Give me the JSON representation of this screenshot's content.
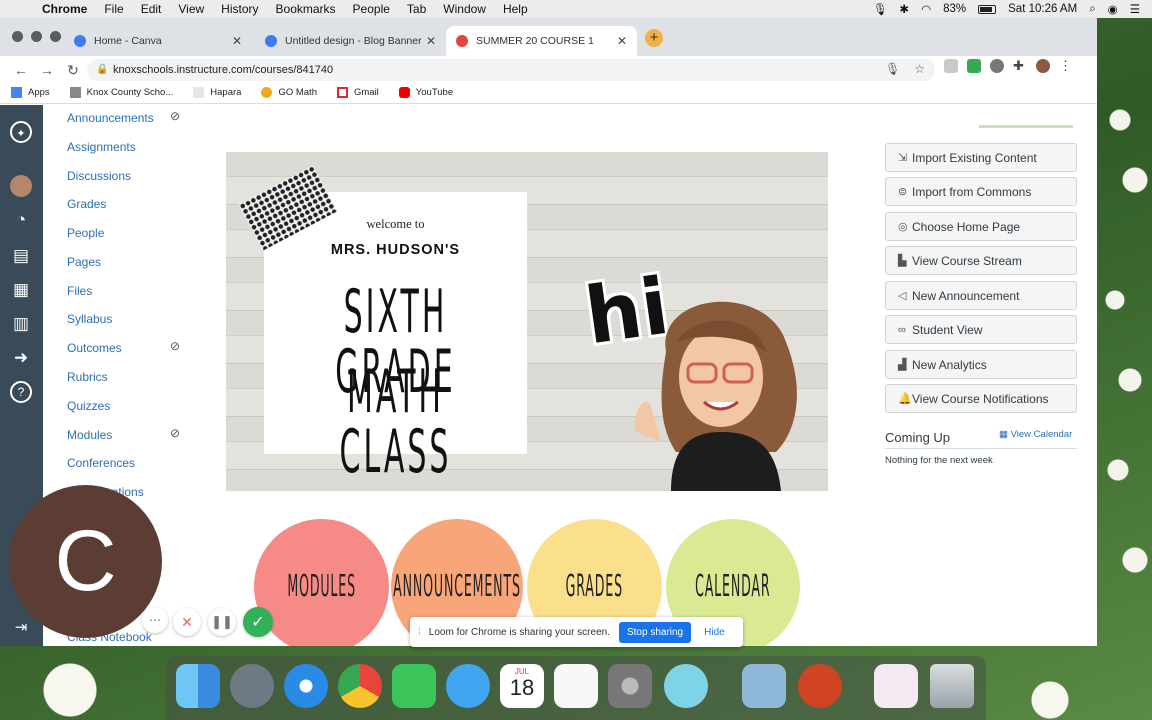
{
  "menubar": {
    "app": "Chrome",
    "items": [
      "File",
      "Edit",
      "View",
      "History",
      "Bookmarks",
      "People",
      "Tab",
      "Window",
      "Help"
    ],
    "battery": "83%",
    "clock": "Sat 10:26 AM"
  },
  "tabs": [
    {
      "title": "Home - Canva",
      "close": "✕"
    },
    {
      "title": "Untitled design - Blog Banner",
      "close": "✕"
    },
    {
      "title": "SUMMER 20 COURSE 1",
      "close": "✕"
    }
  ],
  "new_tab": "+",
  "address": {
    "url": "knoxschools.instructure.com/courses/841740"
  },
  "bookmarks": [
    "Apps",
    "Knox County Scho...",
    "Hapara",
    "GO Math",
    "Gmail",
    "YouTube"
  ],
  "course_nav": [
    {
      "label": "Announcements",
      "hidden": true
    },
    {
      "label": "Assignments"
    },
    {
      "label": "Discussions"
    },
    {
      "label": "Grades"
    },
    {
      "label": "People"
    },
    {
      "label": "Pages"
    },
    {
      "label": "Files"
    },
    {
      "label": "Syllabus"
    },
    {
      "label": "Outcomes",
      "hidden": true
    },
    {
      "label": "Rubrics"
    },
    {
      "label": "Quizzes"
    },
    {
      "label": "Modules",
      "hidden": true
    },
    {
      "label": "Conferences"
    },
    {
      "label": "Collaborations"
    },
    {
      "label": "Class Notebook"
    }
  ],
  "hero": {
    "welcome": "welcome to",
    "name": "MRS. HUDSON'S",
    "title_line1": "SIXTH GRADE",
    "title_line2": "MATH CLASS",
    "greeting": "hi"
  },
  "quick_links": [
    {
      "label": "MODULES",
      "color": "#f58a87"
    },
    {
      "label": "ANNOUNCEMENTS",
      "color": "#f8a57a"
    },
    {
      "label": "GRADES",
      "color": "#fbe08c"
    },
    {
      "label": "CALENDAR",
      "color": "#d9ea93"
    }
  ],
  "sidebar": {
    "buttons": [
      {
        "label": "Import Existing Content",
        "icon": "import-icon"
      },
      {
        "label": "Import from Commons",
        "icon": "commons-icon"
      },
      {
        "label": "Choose Home Page",
        "icon": "target-icon"
      },
      {
        "label": "View Course Stream",
        "icon": "stream-icon"
      },
      {
        "label": "New Announcement",
        "icon": "megaphone-icon"
      },
      {
        "label": "Student View",
        "icon": "glasses-icon"
      },
      {
        "label": "New Analytics",
        "icon": "analytics-icon"
      },
      {
        "label": "View Course Notifications",
        "icon": "bell-icon"
      }
    ],
    "coming_up": "Coming Up",
    "view_calendar": "View Calendar",
    "nothing": "Nothing for the next week"
  },
  "loom": {
    "message": "Loom for Chrome is sharing your screen.",
    "stop": "Stop sharing",
    "hide": "Hide",
    "avatar_letter": "C"
  },
  "dock": {
    "calendar_month": "JUL",
    "calendar_day": "18"
  }
}
